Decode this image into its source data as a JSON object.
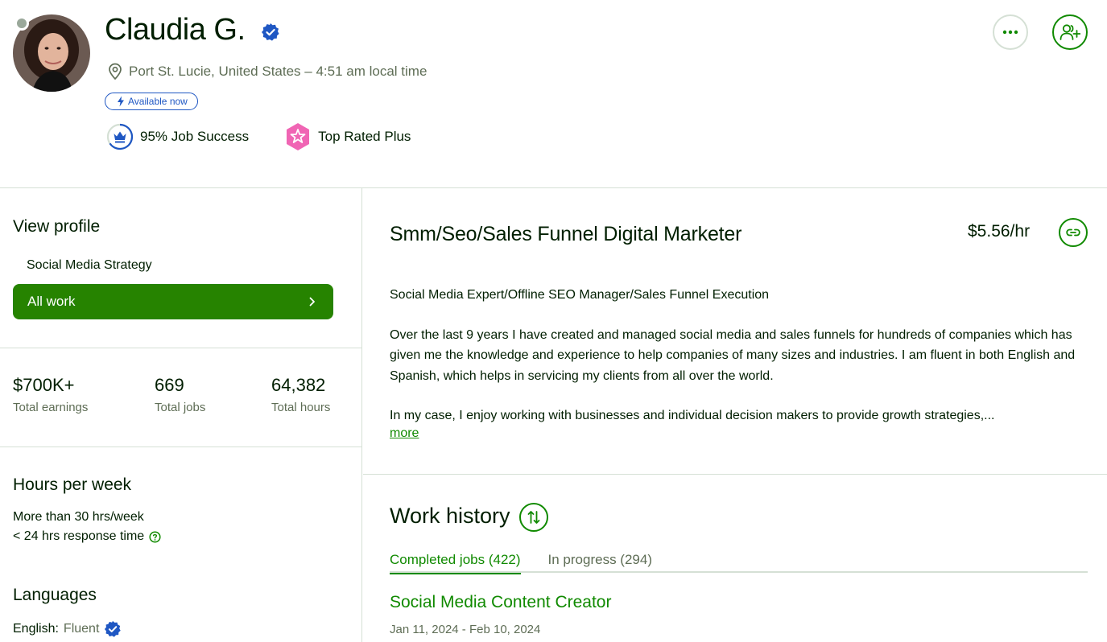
{
  "profile": {
    "name": "Claudia G.",
    "location": "Port St. Lucie, United States – 4:51 am local time",
    "availability": "Available now",
    "job_success": "95% Job Success",
    "top_rated": "Top Rated Plus",
    "verified_color": "#1f57c3",
    "accent_color": "#108a00"
  },
  "sidebar": {
    "view_profile_title": "View profile",
    "specialty": "Social Media Strategy",
    "all_work_label": "All work",
    "stats": [
      {
        "value": "$700K+",
        "label": "Total earnings"
      },
      {
        "value": "669",
        "label": "Total jobs"
      },
      {
        "value": "64,382",
        "label": "Total hours"
      }
    ],
    "hours_title": "Hours per week",
    "hours_value": "More than 30 hrs/week",
    "response_time": "< 24 hrs response time",
    "languages_title": "Languages",
    "language": {
      "name": "English:",
      "level": "Fluent"
    }
  },
  "main": {
    "title": "Smm/Seo/Sales Funnel Digital Marketer",
    "rate": "$5.56/hr",
    "overview": [
      "Social Media Expert/Offline SEO Manager/Sales Funnel Execution",
      "Over the last 9 years I have created and managed social media and sales funnels for hundreds of companies which has given me the knowledge and experience to help companies of many sizes and industries. I am fluent in both English and Spanish, which helps in servicing my clients from all over the world.",
      "In my case, I enjoy working with businesses and individual decision makers to provide growth strategies,..."
    ],
    "more_label": "more"
  },
  "work_history": {
    "title": "Work history",
    "tabs": [
      {
        "label": "Completed jobs (422)",
        "active": true
      },
      {
        "label": "In progress (294)",
        "active": false
      }
    ],
    "jobs": [
      {
        "title": "Social Media Content Creator",
        "dates": "Jan 11, 2024 - Feb 10, 2024"
      }
    ]
  },
  "icons": {
    "location": "map-pin-icon",
    "bolt": "lightning-icon",
    "job_success": "crown-icon",
    "top_rated": "star-badge-icon",
    "more": "ellipsis-icon",
    "invite": "add-user-icon",
    "link": "link-icon",
    "sort": "sort-arrows-icon",
    "chevron": "chevron-right-icon",
    "help": "question-circle-icon",
    "verified": "verified-check-icon"
  }
}
